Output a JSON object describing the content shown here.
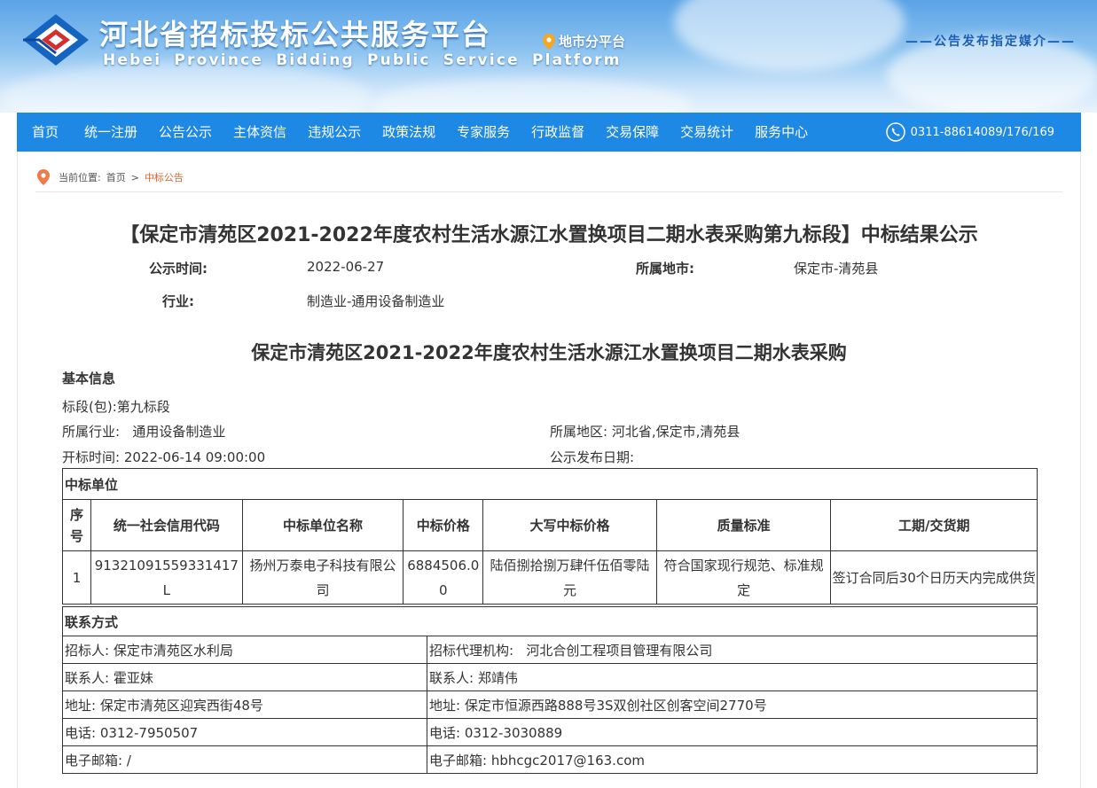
{
  "header": {
    "title_cn": "河北省招标投标公共服务平台",
    "title_en": "Hebei Province Bidding Public Service Platform",
    "city_platform": "地市分平台",
    "media_slogan": "——公告发布指定媒介——",
    "brand_color": "#1e88e5",
    "icons": [
      "logo",
      "location-pin-icon"
    ]
  },
  "nav": {
    "items": [
      "首页",
      "统一注册",
      "公告公示",
      "主体资信",
      "违规公示",
      "政策法规",
      "专家服务",
      "行政监督",
      "交易保障",
      "交易统计",
      "服务中心"
    ],
    "phone": "0311-88614089/176/169",
    "phone_icon": "phone-icon"
  },
  "breadcrumb": {
    "prefix": "当前位置:",
    "home": "首页",
    "separator": ">",
    "current": "中标公告"
  },
  "notice": {
    "title": "【保定市清苑区2021-2022年度农村生活水源江水置换项目二期水表采购第九标段】中标结果公示",
    "publish_time_label": "公示时间:",
    "publish_time": "2022-06-27",
    "region_label": "所属地市:",
    "region": "保定市-清苑县",
    "industry_label": "行业:",
    "industry": "制造业-通用设备制造业"
  },
  "doc": {
    "title": "保定市清苑区2021-2022年度农村生活水源江水置换项目二期水表采购",
    "basic_info_label": "基本信息",
    "section": "标段(包):第九标段",
    "industry": "所属行业:   通用设备制造业",
    "area": "所属地区:  河北省,保定市,清苑县",
    "open_time": "开标时间:  2022-06-14 09:00:00",
    "publish_date": "公示发布日期:"
  },
  "winner": {
    "section_title": "中标单位",
    "headers": [
      "序号",
      "统一社会信用代码",
      "中标单位名称",
      "中标价格",
      "大写中标价格",
      "质量标准",
      "工期/交货期"
    ],
    "rows": [
      [
        "1",
        "91321091559331417L",
        "扬州万泰电子科技有限公司",
        "6884506.00",
        "陆佰捌拾捌万肆仟伍佰零陆元",
        "符合国家现行规范、标准规定",
        "签订合同后30个日历天内完成供货"
      ]
    ]
  },
  "contact": {
    "section_title": "联系方式",
    "rows": [
      [
        "招标人:  保定市清苑区水利局",
        "招标代理机构:   河北合创工程项目管理有限公司"
      ],
      [
        "联系人:  霍亚妹",
        "联系人:  郑靖伟"
      ],
      [
        "地址:  保定市清苑区迎宾西街48号",
        "地址:  保定市恒源西路888号3S双创社区创客空间2770号"
      ],
      [
        "电话:  0312-7950507",
        "电话:  0312-3030889"
      ],
      [
        "电子邮箱:  /",
        "电子邮箱:  hbhcgc2017@163.com"
      ]
    ]
  }
}
